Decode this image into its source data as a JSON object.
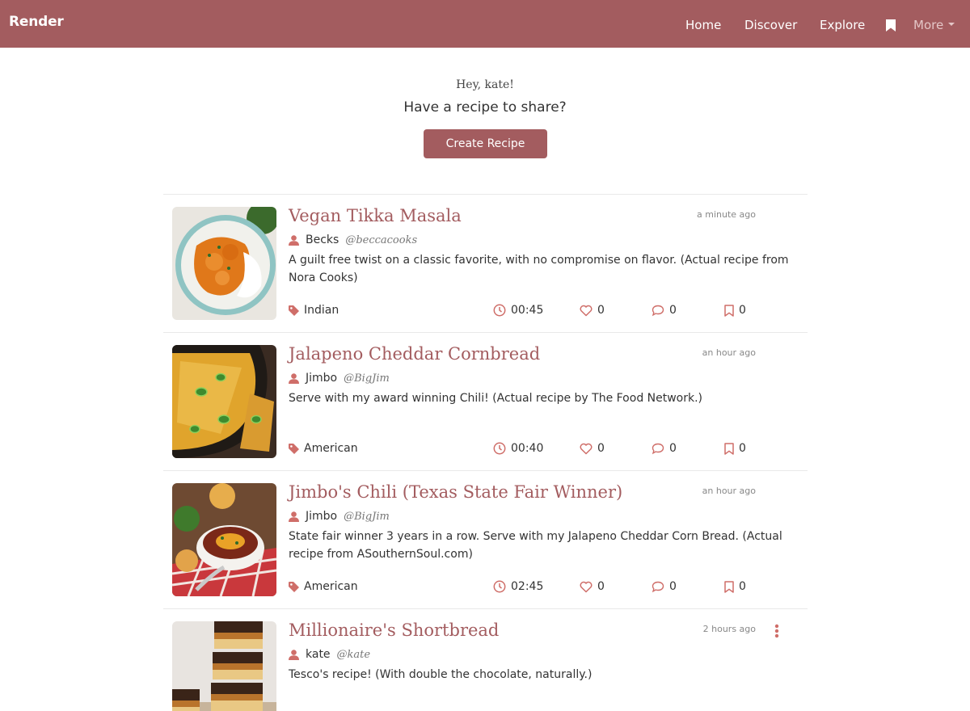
{
  "colors": {
    "brand": "#a35c5f",
    "accent_icon": "#cf6e69"
  },
  "nav": {
    "brand": "Render",
    "links": [
      "Home",
      "Discover",
      "Explore"
    ],
    "bookmark_icon": "bookmark-icon",
    "more_label": "More"
  },
  "hero": {
    "greeting": "Hey, kate!",
    "prompt": "Have a recipe to share?",
    "button_label": "Create Recipe"
  },
  "recipes": [
    {
      "title": "Vegan Tikka Masala",
      "time_ago": "a minute ago",
      "author": "Becks",
      "handle": "@beccacooks",
      "description": "A guilt free twist on a classic favorite, with no compromise on flavor. (Actual recipe from Nora Cooks)",
      "tag": "Indian",
      "duration": "00:45",
      "likes": "0",
      "comments": "0",
      "saves": "0"
    },
    {
      "title": "Jalapeno Cheddar Cornbread",
      "time_ago": "an hour ago",
      "author": "Jimbo",
      "handle": "@BigJim",
      "description": "Serve with my award winning Chili! (Actual recipe by The Food Network.)",
      "tag": "American",
      "duration": "00:40",
      "likes": "0",
      "comments": "0",
      "saves": "0"
    },
    {
      "title": "Jimbo's Chili (Texas State Fair Winner)",
      "time_ago": "an hour ago",
      "author": "Jimbo",
      "handle": "@BigJim",
      "description": "State fair winner 3 years in a row. Serve with my Jalapeno Cheddar Corn Bread. (Actual recipe from ASouthernSoul.com)",
      "tag": "American",
      "duration": "02:45",
      "likes": "0",
      "comments": "0",
      "saves": "0"
    },
    {
      "title": "Millionaire's Shortbread",
      "time_ago": "2 hours ago",
      "author": "kate",
      "handle": "@kate",
      "description": "Tesco's recipe! (With double the chocolate, naturally.)",
      "has_menu": true
    }
  ]
}
